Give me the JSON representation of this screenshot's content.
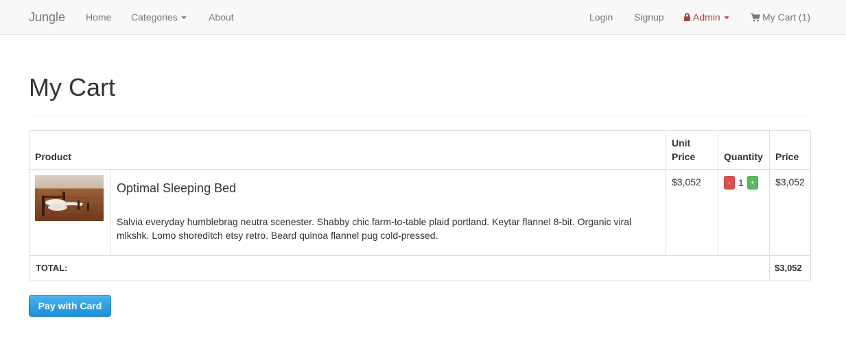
{
  "nav": {
    "brand": "Jungle",
    "home": "Home",
    "categories": "Categories",
    "about": "About",
    "login": "Login",
    "signup": "Signup",
    "admin": "Admin",
    "cart": "My Cart (1)",
    "admin_color": "#a94442"
  },
  "page": {
    "title": "My Cart"
  },
  "table": {
    "headers": {
      "product": "Product",
      "unit_price": "Unit Price",
      "quantity": "Quantity",
      "price": "Price"
    },
    "items": [
      {
        "name": "Optimal Sleeping Bed",
        "description": "Salvia everyday humblebrag neutra scenester. Shabby chic farm-to-table plaid portland. Keytar flannel 8-bit. Organic viral mlkshk. Lomo shoreditch etsy retro. Beard quinoa flannel pug cold-pressed.",
        "unit_price": "$3,052",
        "quantity": "1",
        "price": "$3,052",
        "minus_label": "-",
        "plus_label": "+"
      }
    ],
    "total_label": "TOTAL:",
    "total_value": "$3,052"
  },
  "actions": {
    "pay_button": "Pay with Card",
    "pay_color": "#1b8fd4"
  }
}
